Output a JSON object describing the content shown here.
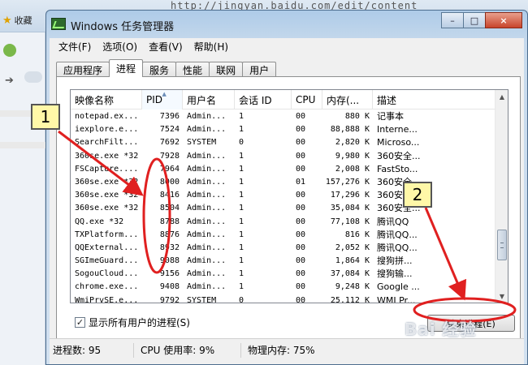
{
  "browser": {
    "favorites_label": "收藏",
    "url_fragment": "http://jingyan.baidu.com/edit/content"
  },
  "window": {
    "title": "Windows 任务管理器",
    "controls": [
      "–",
      "□",
      "×"
    ]
  },
  "menu": [
    "文件(F)",
    "选项(O)",
    "查看(V)",
    "帮助(H)"
  ],
  "tabs": [
    {
      "label": "应用程序",
      "active": false
    },
    {
      "label": "进程",
      "active": true
    },
    {
      "label": "服务",
      "active": false
    },
    {
      "label": "性能",
      "active": false
    },
    {
      "label": "联网",
      "active": false
    },
    {
      "label": "用户",
      "active": false
    }
  ],
  "process_table": {
    "columns": [
      "映像名称",
      "PID",
      "用户名",
      "会话 ID",
      "CPU",
      "内存(...",
      "描述"
    ],
    "sorted_column": "PID",
    "rows": [
      [
        "notepad.ex...",
        "7396",
        "Admin...",
        "1",
        "00",
        "880 K",
        "记事本"
      ],
      [
        "iexplore.e...",
        "7524",
        "Admin...",
        "1",
        "00",
        "88,888 K",
        "Interne..."
      ],
      [
        "SearchFilt...",
        "7692",
        "SYSTEM",
        "0",
        "00",
        "2,820 K",
        "Microso..."
      ],
      [
        "360se.exe *32",
        "7928",
        "Admin...",
        "1",
        "00",
        "9,980 K",
        "360安全..."
      ],
      [
        "FSCapture....",
        "7964",
        "Admin...",
        "1",
        "00",
        "2,008 K",
        "FastSto..."
      ],
      [
        "360se.exe *32",
        "8000",
        "Admin...",
        "1",
        "01",
        "157,276 K",
        "360安全..."
      ],
      [
        "360se.exe *32",
        "8416",
        "Admin...",
        "1",
        "00",
        "17,296 K",
        "360安全..."
      ],
      [
        "360se.exe *32",
        "8504",
        "Admin...",
        "1",
        "00",
        "35,084 K",
        "360安全..."
      ],
      [
        "QQ.exe *32",
        "8788",
        "Admin...",
        "1",
        "00",
        "77,108 K",
        "腾讯QQ"
      ],
      [
        "TXPlatform...",
        "8876",
        "Admin...",
        "1",
        "00",
        "816 K",
        "腾讯QQ..."
      ],
      [
        "QQExternal...",
        "8932",
        "Admin...",
        "1",
        "00",
        "2,052 K",
        "腾讯QQ..."
      ],
      [
        "SGImeGuard...",
        "9088",
        "Admin...",
        "1",
        "00",
        "1,864 K",
        "搜狗拼..."
      ],
      [
        "SogouCloud...",
        "9156",
        "Admin...",
        "1",
        "00",
        "37,084 K",
        "搜狗输..."
      ],
      [
        "chrome.exe...",
        "9408",
        "Admin...",
        "1",
        "00",
        "9,248 K",
        "Google ..."
      ],
      [
        "WmiPrvSE.e...",
        "9792",
        "SYSTEM",
        "0",
        "00",
        "25,112 K",
        "WMI Pr..."
      ]
    ]
  },
  "show_all_users": {
    "label": "显示所有用户的进程(S)",
    "checked": true,
    "check_glyph": "✓"
  },
  "end_process_button": "结束进程(E)",
  "status": {
    "processes": "进程数: 95",
    "cpu": "CPU 使用率: 9%",
    "memory": "物理内存: 75%"
  },
  "annotations": {
    "badge1": "1",
    "badge2": "2",
    "highlight_color": "#e02020",
    "badge_fill": "#fff8a8"
  },
  "watermark": "Bai 经验"
}
